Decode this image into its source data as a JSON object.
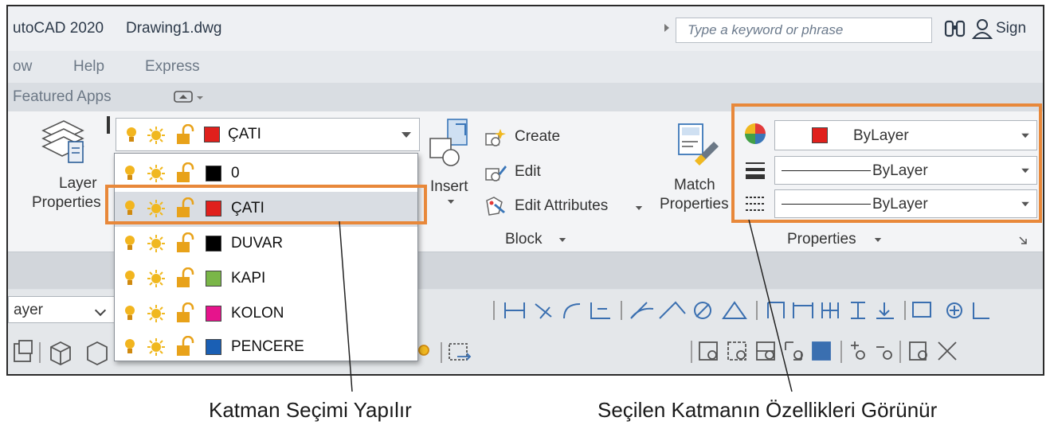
{
  "titlebar": {
    "app_title": "utoCAD 2020",
    "file_name": "Drawing1.dwg",
    "search_placeholder": "Type a keyword or phrase",
    "sign_in_label": "Sign"
  },
  "menubar": {
    "items": [
      "ow",
      "Help",
      "Express"
    ]
  },
  "tabbar": {
    "featured_apps_label": "Featured Apps"
  },
  "ribbon": {
    "layer_properties": [
      "Layer",
      "Properties"
    ],
    "current_layer": {
      "name": "ÇATI",
      "color": "#e0201c"
    },
    "insert_label": "Insert",
    "block": {
      "create_label": "Create",
      "edit_label": "Edit",
      "edit_attributes_label": "Edit Attributes",
      "panel_label": "Block"
    },
    "match_properties": [
      "Match",
      "Properties"
    ],
    "properties": {
      "color_value": "ByLayer",
      "color_swatch": "#e0201c",
      "lineweight_value": "ByLayer",
      "linetype_value": "ByLayer",
      "panel_label": "Properties"
    }
  },
  "layers": [
    {
      "name": "0",
      "color": "#000000"
    },
    {
      "name": "ÇATI",
      "color": "#e0201c"
    },
    {
      "name": "DUVAR",
      "color": "#000000"
    },
    {
      "name": "KAPI",
      "color": "#7ab648"
    },
    {
      "name": "KOLON",
      "color": "#e6148c"
    },
    {
      "name": "PENCERE",
      "color": "#1a5fb4"
    }
  ],
  "toolbar": {
    "layer_combo_value": "ayer"
  },
  "captions": {
    "left": "Katman Seçimi Yapılır",
    "right": "Seçilen Katmanın Özellikleri Görünür"
  },
  "colors": {
    "highlight": "#e8883a",
    "bulb": "#f2b51f",
    "sun": "#f0b820",
    "lock": "#e8a21a"
  }
}
